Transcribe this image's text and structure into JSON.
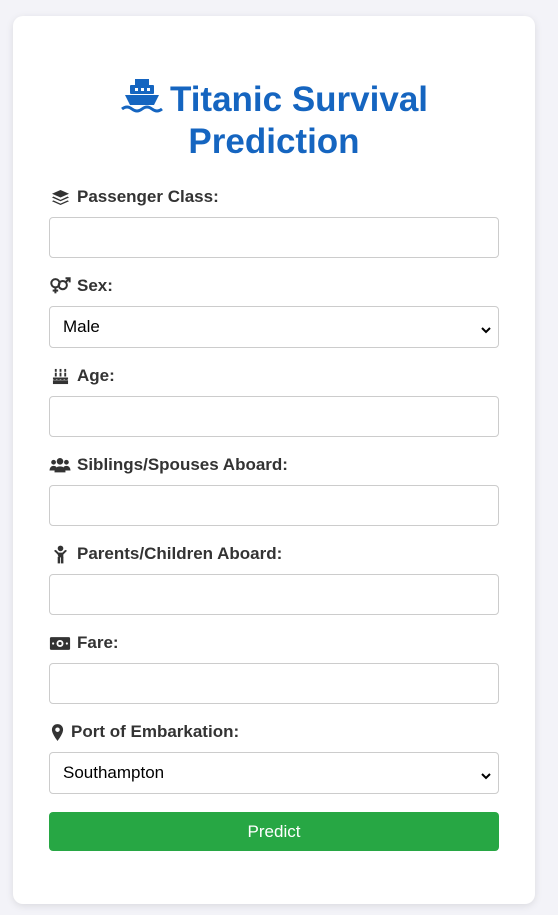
{
  "page": {
    "title_line1": "Titanic Survival",
    "title_line2": "Prediction",
    "title_icon": "ship-icon"
  },
  "colors": {
    "accent": "#1565c0",
    "button": "#27a744",
    "background": "#f3f3f8"
  },
  "fields": {
    "pclass": {
      "label": "Passenger Class:",
      "icon": "layer-group-icon",
      "value": ""
    },
    "sex": {
      "label": "Sex:",
      "icon": "venus-mars-icon",
      "selected": "Male"
    },
    "age": {
      "label": "Age:",
      "icon": "birthday-cake-icon",
      "value": ""
    },
    "sibsp": {
      "label": "Siblings/Spouses Aboard:",
      "icon": "users-icon",
      "value": ""
    },
    "parch": {
      "label": "Parents/Children Aboard:",
      "icon": "child-icon",
      "value": ""
    },
    "fare": {
      "label": "Fare:",
      "icon": "money-bill-icon",
      "value": ""
    },
    "embarked": {
      "label": "Port of Embarkation:",
      "icon": "map-marker-icon",
      "selected": "Southampton"
    }
  },
  "actions": {
    "predict_label": "Predict"
  }
}
